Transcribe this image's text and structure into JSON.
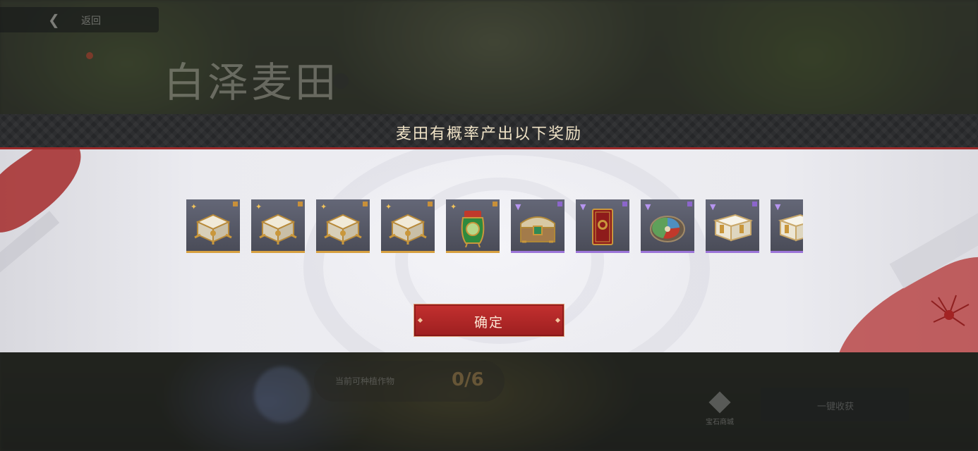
{
  "background": {
    "back_label": "返回",
    "map_title": "白泽麦田",
    "bottom_hint": "当前可种植作物",
    "bottom_number": "0/6",
    "bottom_gem_label": "宝石商城",
    "bottom_button_label": "一键收获"
  },
  "modal": {
    "title": "麦田有概率产出以下奖励",
    "confirm_label": "确定",
    "accent_color": "#9c2a2a"
  },
  "rewards": [
    {
      "rarity": "gold",
      "icon": "white-gold-chest-icon"
    },
    {
      "rarity": "gold",
      "icon": "white-gold-chest-icon"
    },
    {
      "rarity": "gold",
      "icon": "white-gold-chest-icon"
    },
    {
      "rarity": "gold",
      "icon": "white-gold-chest-icon"
    },
    {
      "rarity": "gold",
      "icon": "green-jade-pouch-icon"
    },
    {
      "rarity": "purple",
      "icon": "ornate-treasure-chest-icon"
    },
    {
      "rarity": "purple",
      "icon": "red-card-icon"
    },
    {
      "rarity": "purple",
      "icon": "tricolor-orb-icon"
    },
    {
      "rarity": "purple",
      "icon": "white-box-icon"
    },
    {
      "rarity": "purple",
      "icon": "white-box-icon"
    }
  ],
  "rarity_colors": {
    "gold": "#d7a040",
    "purple": "#9b74d8"
  }
}
